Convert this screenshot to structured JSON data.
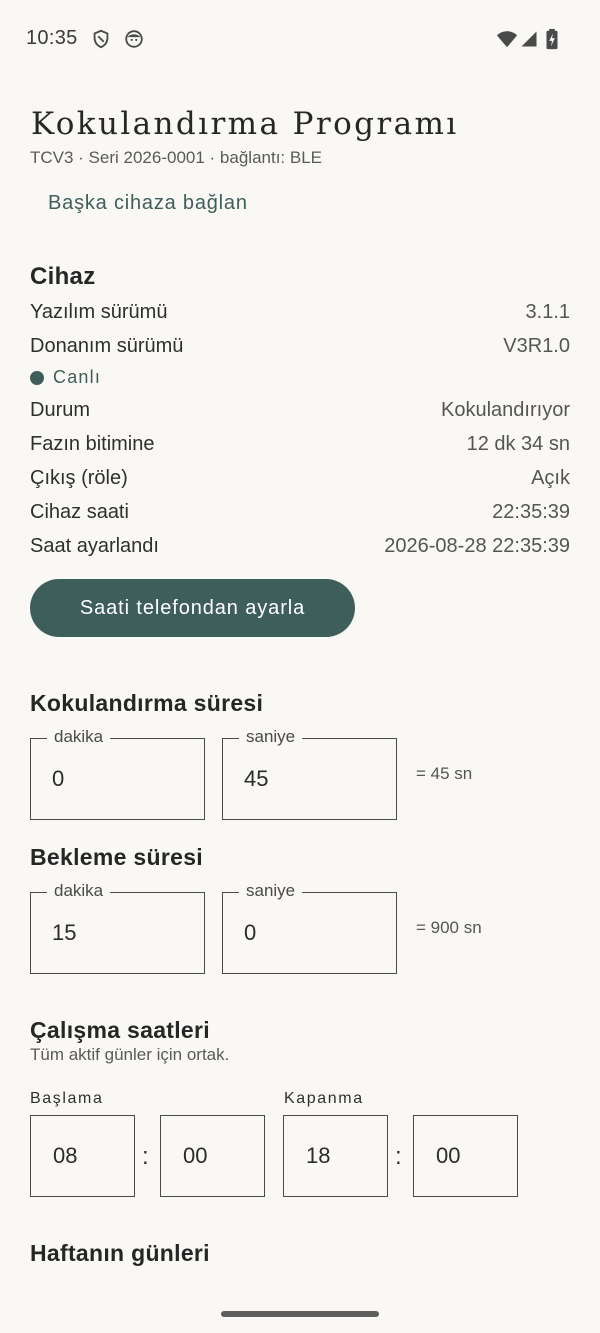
{
  "status_bar": {
    "time": "10:35",
    "left_icons": [
      "shield-icon",
      "face-icon"
    ],
    "right_icons": [
      "wifi-icon",
      "signal-icon",
      "battery-charging-icon"
    ]
  },
  "header": {
    "title": "Kokulandırma Programı",
    "subtitle": "TCV3 · Seri 2026-0001 · bağlantı: BLE",
    "connect_other_label": "Başka cihaza bağlan"
  },
  "device": {
    "heading": "Cihaz",
    "rows_top": [
      {
        "label": "Yazılım sürümü",
        "value": "3.1.1"
      },
      {
        "label": "Donanım sürümü",
        "value": "V3R1.0"
      }
    ],
    "live_label": "Canlı",
    "rows_bottom": [
      {
        "label": "Durum",
        "value": "Kokulandırıyor"
      },
      {
        "label": "Fazın bitimine",
        "value": "12 dk 34 sn"
      },
      {
        "label": "Çıkış (röle)",
        "value": "Açık"
      },
      {
        "label": "Cihaz saati",
        "value": "22:35:39"
      },
      {
        "label": "Saat ayarlandı",
        "value": "2026-08-28 22:35:39"
      }
    ],
    "set_clock_label": "Saati telefondan ayarla"
  },
  "scent_duration": {
    "heading": "Kokulandırma süresi",
    "minutes_label": "dakika",
    "minutes_value": "0",
    "seconds_label": "saniye",
    "seconds_value": "45",
    "equivalent": "= 45 sn"
  },
  "wait_duration": {
    "heading": "Bekleme süresi",
    "minutes_label": "dakika",
    "minutes_value": "15",
    "seconds_label": "saniye",
    "seconds_value": "0",
    "equivalent": "= 900 sn"
  },
  "working_hours": {
    "heading": "Çalışma saatleri",
    "note": "Tüm aktif günler için ortak.",
    "start_label": "Başlama",
    "start_hour": "08",
    "start_minute": "00",
    "end_label": "Kapanma",
    "end_hour": "18",
    "end_minute": "00",
    "separator": ":"
  },
  "weekdays": {
    "heading": "Haftanın günleri"
  },
  "colors": {
    "accent": "#3e5e5c",
    "background": "#faf8f5",
    "text": "#2b2b2b"
  }
}
